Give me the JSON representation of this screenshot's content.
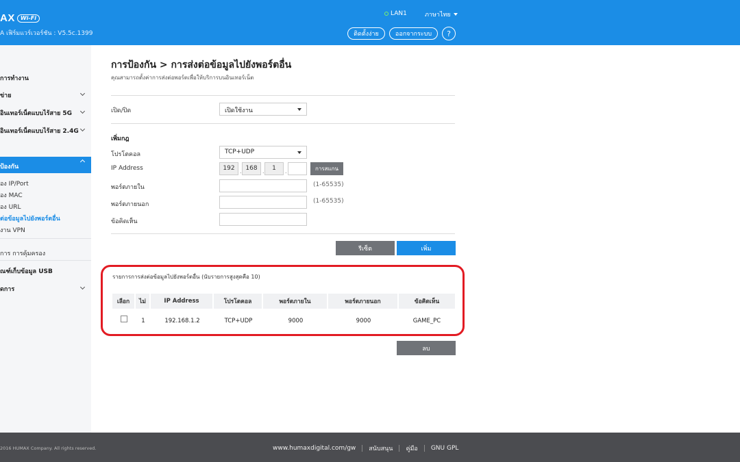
{
  "header": {
    "brand": "AX",
    "wifi_badge": "Wi-Fi",
    "firmware": "A เฟิร์มแวร์เวอร์ชัน : V5.5c.1399",
    "lan_label": "LAN1",
    "language": "ภาษาไทย",
    "setup_label": "ติดตั้งง่าย",
    "logout_label": "ออกจากระบบ",
    "help_label": "?"
  },
  "sidebar": {
    "status": "การทำงาน",
    "network": "ข่าย",
    "wifi5g": "อินเทอร์เน็ตแบบไร้สาย 5G",
    "wifi24g": "อินเทอร์เน็ตแบบไร้สาย 2.4G",
    "security": "ป้องกัน",
    "sub": [
      "อง IP/Port",
      "อง MAC",
      "อง URL",
      "ต่อข้อมูลไปยังพอร์ตอื่น",
      "งาน VPN"
    ],
    "management": "การ การคุ้มครอง",
    "usb": "ณฑ์เก็บข้อมูล USB",
    "admin": "ดการ"
  },
  "main": {
    "title": "การป้องกัน > การส่งต่อข้อมูลไปยังพอร์ตอื่น",
    "subtitle": "คุณสามารถตั้งค่าการส่งต่อพอร์ตเพื่อให้บริการบนอินเทอร์เน็ต",
    "enable_label": "เปิด/ปิด",
    "enable_value": "เปิดใช้งาน",
    "add_rule_heading": "เพิ่มกฎ",
    "protocol_label": "โปรโตคอล",
    "protocol_value": "TCP+UDP",
    "ip_label": "IP Address",
    "ip_octets": [
      "192",
      "168",
      "1",
      ""
    ],
    "scan_label": "การสแกน",
    "internal_port_label": "พอร์ตภายใน",
    "external_port_label": "พอร์ตภายนอก",
    "port_range_hint": "(1-65535)",
    "comment_label": "ข้อคิดเห็น",
    "reset_label": "รีเซ็ต",
    "add_label": "เพิ่ม",
    "delete_label": "ลบ"
  },
  "rules": {
    "title": "รายการการส่งต่อข้อมูลไปยังพอร์ตอื่น  (นับรายการสูงสุดคือ 10)",
    "columns": [
      "เลือก",
      "ไม่",
      "IP Address",
      "โปรโตคอล",
      "พอร์ตภายใน",
      "พอร์ตภายนอก",
      "ข้อคิดเห็น"
    ],
    "rows": [
      {
        "no": "1",
        "ip": "192.168.1.2",
        "protocol": "TCP+UDP",
        "internal": "9000",
        "external": "9000",
        "comment": "GAME_PC"
      }
    ]
  },
  "footer": {
    "copyright": "2016 HUMAX Company. All rights reserved.",
    "website": "www.humaxdigital.com/gw",
    "support": "สนับสนุน",
    "manual": "คู่มือ",
    "gpl": "GNU GPL"
  }
}
